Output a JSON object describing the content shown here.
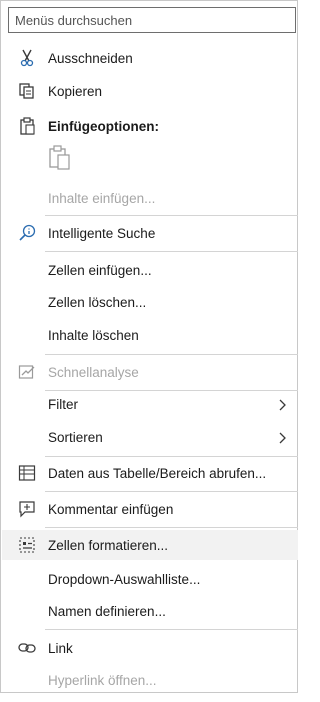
{
  "search": {
    "placeholder": "Menüs durchsuchen"
  },
  "menu": {
    "cut": "Ausschneiden",
    "copy": "Kopieren",
    "paste_options_header": "Einfügeoptionen:",
    "paste_special": "Inhalte einfügen...",
    "smart_lookup": "Intelligente Suche",
    "insert_cells": "Zellen einfügen...",
    "delete_cells": "Zellen löschen...",
    "clear_contents": "Inhalte löschen",
    "quick_analysis": "Schnellanalyse",
    "filter": "Filter",
    "sort": "Sortieren",
    "get_data": "Daten aus Tabelle/Bereich abrufen...",
    "insert_comment": "Kommentar einfügen",
    "format_cells": "Zellen formatieren...",
    "dropdown_list": "Dropdown-Auswahlliste...",
    "define_name": "Namen definieren...",
    "link": "Link",
    "open_hyperlink": "Hyperlink öffnen..."
  },
  "colors": {
    "highlight": "#f2f2f2",
    "disabled": "#a6a6a6",
    "accent": "#2b6cb0"
  }
}
